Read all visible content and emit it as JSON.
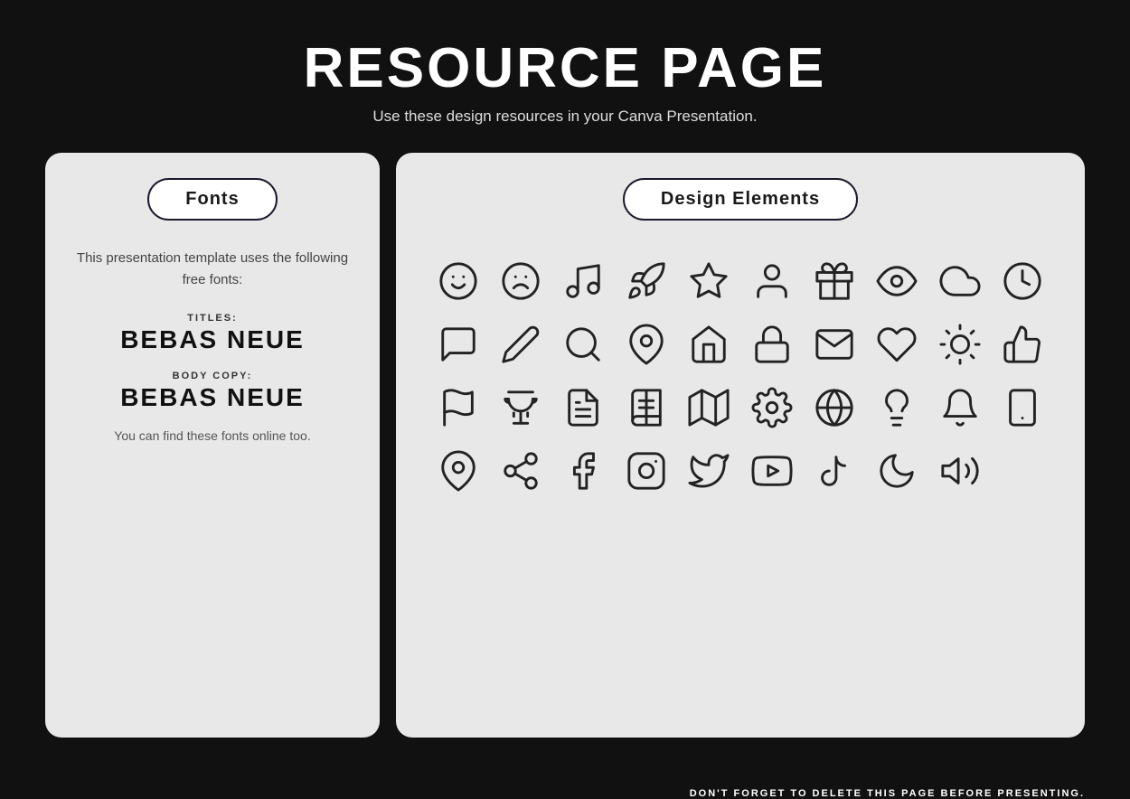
{
  "header": {
    "title": "RESOURCE PAGE",
    "subtitle": "Use these design resources in your Canva Presentation."
  },
  "fonts_panel": {
    "button_label": "Fonts",
    "description": "This presentation template uses the following free fonts:",
    "titles_label": "TITLES:",
    "titles_font": "BEBAS NEUE",
    "body_label": "BODY COPY:",
    "body_font": "BEBAS NEUE",
    "note": "You can find these fonts online too."
  },
  "design_panel": {
    "button_label": "Design Elements"
  },
  "footer": {
    "note": "DON'T FORGET TO DELETE THIS PAGE BEFORE PRESENTING."
  }
}
